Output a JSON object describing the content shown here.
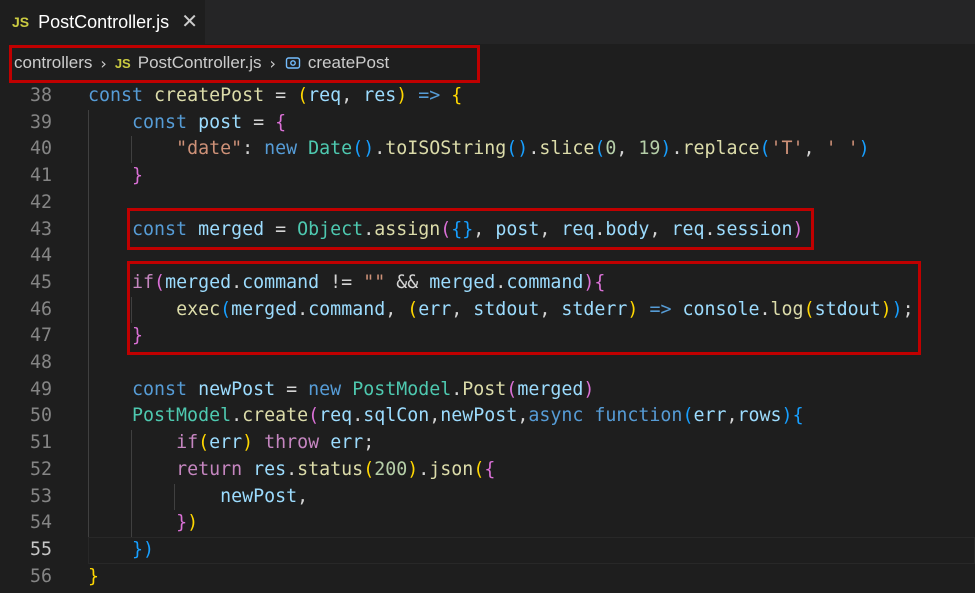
{
  "tab": {
    "badge": "JS",
    "title": "PostController.js",
    "close": "✕"
  },
  "breadcrumb": {
    "folder": "controllers",
    "file_badge": "JS",
    "file": "PostController.js",
    "symbol": "createPost"
  },
  "code_lines": [
    {
      "num": "38",
      "tokens": [
        [
          "k",
          "const "
        ],
        [
          "f",
          "createPost"
        ],
        [
          "o",
          " = "
        ],
        [
          "b1",
          "("
        ],
        [
          "v",
          "req"
        ],
        [
          "o",
          ", "
        ],
        [
          "v",
          "res"
        ],
        [
          "b1",
          ")"
        ],
        [
          "o",
          " "
        ],
        [
          "k",
          "=>"
        ],
        [
          "o",
          " "
        ],
        [
          "b1",
          "{"
        ]
      ]
    },
    {
      "num": "39",
      "tokens": [
        [
          "o",
          "    "
        ],
        [
          "k",
          "const "
        ],
        [
          "v",
          "post"
        ],
        [
          "o",
          " = "
        ],
        [
          "b2",
          "{"
        ]
      ]
    },
    {
      "num": "40",
      "tokens": [
        [
          "o",
          "        "
        ],
        [
          "s",
          "\"date\""
        ],
        [
          "o",
          ": "
        ],
        [
          "k",
          "new "
        ],
        [
          "c",
          "Date"
        ],
        [
          "b3",
          "()"
        ],
        [
          "o",
          "."
        ],
        [
          "f",
          "toISOString"
        ],
        [
          "b3",
          "()"
        ],
        [
          "o",
          "."
        ],
        [
          "f",
          "slice"
        ],
        [
          "b3",
          "("
        ],
        [
          "n",
          "0"
        ],
        [
          "o",
          ", "
        ],
        [
          "n",
          "19"
        ],
        [
          "b3",
          ")"
        ],
        [
          "o",
          "."
        ],
        [
          "f",
          "replace"
        ],
        [
          "b3",
          "("
        ],
        [
          "s",
          "'T'"
        ],
        [
          "o",
          ", "
        ],
        [
          "s",
          "' '"
        ],
        [
          "b3",
          ")"
        ]
      ]
    },
    {
      "num": "41",
      "tokens": [
        [
          "o",
          "    "
        ],
        [
          "b2",
          "}"
        ]
      ]
    },
    {
      "num": "42",
      "tokens": []
    },
    {
      "num": "43",
      "tokens": [
        [
          "o",
          "    "
        ],
        [
          "k",
          "const "
        ],
        [
          "v",
          "merged"
        ],
        [
          "o",
          " = "
        ],
        [
          "c",
          "Object"
        ],
        [
          "o",
          "."
        ],
        [
          "f",
          "assign"
        ],
        [
          "b2",
          "("
        ],
        [
          "b3",
          "{}"
        ],
        [
          "o",
          ", "
        ],
        [
          "v",
          "post"
        ],
        [
          "o",
          ", "
        ],
        [
          "v",
          "req"
        ],
        [
          "o",
          "."
        ],
        [
          "v",
          "body"
        ],
        [
          "o",
          ", "
        ],
        [
          "v",
          "req"
        ],
        [
          "o",
          "."
        ],
        [
          "v",
          "session"
        ],
        [
          "b2",
          ")"
        ]
      ]
    },
    {
      "num": "44",
      "tokens": []
    },
    {
      "num": "45",
      "tokens": [
        [
          "o",
          "    "
        ],
        [
          "kc",
          "if"
        ],
        [
          "b2",
          "("
        ],
        [
          "v",
          "merged"
        ],
        [
          "o",
          "."
        ],
        [
          "v",
          "command"
        ],
        [
          "o",
          " != "
        ],
        [
          "s",
          "\"\""
        ],
        [
          "o",
          " && "
        ],
        [
          "v",
          "merged"
        ],
        [
          "o",
          "."
        ],
        [
          "v",
          "command"
        ],
        [
          "b2",
          ")"
        ],
        [
          "b2",
          "{"
        ]
      ]
    },
    {
      "num": "46",
      "tokens": [
        [
          "o",
          "        "
        ],
        [
          "f",
          "exec"
        ],
        [
          "b3",
          "("
        ],
        [
          "v",
          "merged"
        ],
        [
          "o",
          "."
        ],
        [
          "v",
          "command"
        ],
        [
          "o",
          ", "
        ],
        [
          "b1",
          "("
        ],
        [
          "v",
          "err"
        ],
        [
          "o",
          ", "
        ],
        [
          "v",
          "stdout"
        ],
        [
          "o",
          ", "
        ],
        [
          "v",
          "stderr"
        ],
        [
          "b1",
          ")"
        ],
        [
          "o",
          " "
        ],
        [
          "k",
          "=>"
        ],
        [
          "o",
          " "
        ],
        [
          "v",
          "console"
        ],
        [
          "o",
          "."
        ],
        [
          "f",
          "log"
        ],
        [
          "b1",
          "("
        ],
        [
          "v",
          "stdout"
        ],
        [
          "b1",
          ")"
        ],
        [
          "b3",
          ")"
        ],
        [
          "o",
          ";"
        ]
      ]
    },
    {
      "num": "47",
      "tokens": [
        [
          "o",
          "    "
        ],
        [
          "b2",
          "}"
        ]
      ]
    },
    {
      "num": "48",
      "tokens": []
    },
    {
      "num": "49",
      "tokens": [
        [
          "o",
          "    "
        ],
        [
          "k",
          "const "
        ],
        [
          "v",
          "newPost"
        ],
        [
          "o",
          " = "
        ],
        [
          "k",
          "new "
        ],
        [
          "c",
          "PostModel"
        ],
        [
          "o",
          "."
        ],
        [
          "f",
          "Post"
        ],
        [
          "b2",
          "("
        ],
        [
          "v",
          "merged"
        ],
        [
          "b2",
          ")"
        ]
      ]
    },
    {
      "num": "50",
      "tokens": [
        [
          "o",
          "    "
        ],
        [
          "c",
          "PostModel"
        ],
        [
          "o",
          "."
        ],
        [
          "f",
          "create"
        ],
        [
          "b2",
          "("
        ],
        [
          "v",
          "req"
        ],
        [
          "o",
          "."
        ],
        [
          "v",
          "sqlCon"
        ],
        [
          "o",
          ","
        ],
        [
          "v",
          "newPost"
        ],
        [
          "o",
          ","
        ],
        [
          "k",
          "async "
        ],
        [
          "k",
          "function"
        ],
        [
          "b3",
          "("
        ],
        [
          "v",
          "err"
        ],
        [
          "o",
          ","
        ],
        [
          "v",
          "rows"
        ],
        [
          "b3",
          ")"
        ],
        [
          "b3",
          "{"
        ]
      ]
    },
    {
      "num": "51",
      "tokens": [
        [
          "o",
          "        "
        ],
        [
          "kc",
          "if"
        ],
        [
          "b1",
          "("
        ],
        [
          "v",
          "err"
        ],
        [
          "b1",
          ")"
        ],
        [
          "o",
          " "
        ],
        [
          "kc",
          "throw "
        ],
        [
          "v",
          "err"
        ],
        [
          "o",
          ";"
        ]
      ]
    },
    {
      "num": "52",
      "tokens": [
        [
          "o",
          "        "
        ],
        [
          "kc",
          "return "
        ],
        [
          "v",
          "res"
        ],
        [
          "o",
          "."
        ],
        [
          "f",
          "status"
        ],
        [
          "b1",
          "("
        ],
        [
          "n",
          "200"
        ],
        [
          "b1",
          ")"
        ],
        [
          "o",
          "."
        ],
        [
          "f",
          "json"
        ],
        [
          "b1",
          "("
        ],
        [
          "b2",
          "{"
        ]
      ]
    },
    {
      "num": "53",
      "tokens": [
        [
          "o",
          "            "
        ],
        [
          "v",
          "newPost"
        ],
        [
          "o",
          ","
        ]
      ]
    },
    {
      "num": "54",
      "tokens": [
        [
          "o",
          "        "
        ],
        [
          "b2",
          "}"
        ],
        [
          "b1",
          ")"
        ]
      ]
    },
    {
      "num": "55",
      "tokens": [
        [
          "o",
          "    "
        ],
        [
          "b3",
          "})"
        ]
      ]
    },
    {
      "num": "56",
      "tokens": [
        [
          "b1",
          "}"
        ]
      ]
    }
  ],
  "active_line": "55",
  "colors": {
    "highlight_border": "#c00000",
    "editor_bg": "#1e1e1e",
    "tabbar_bg": "#252526"
  }
}
